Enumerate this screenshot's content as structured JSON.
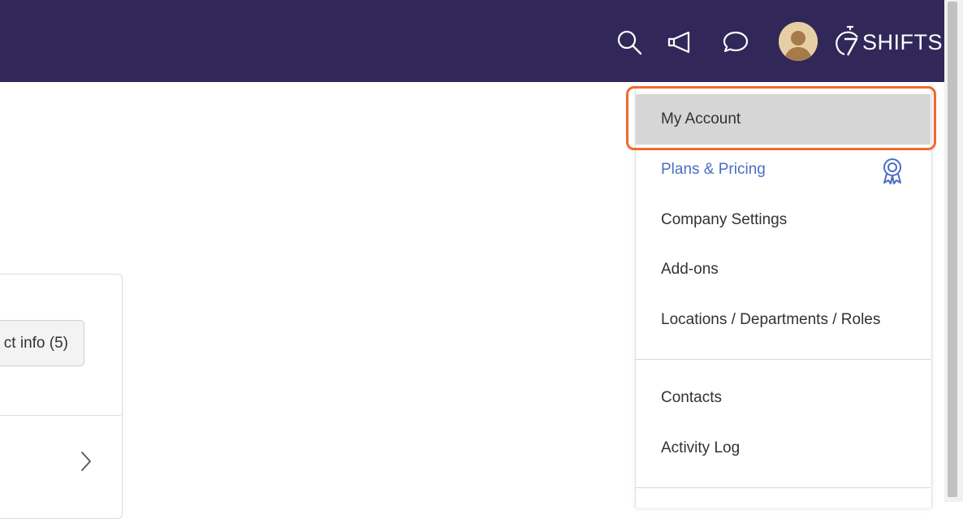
{
  "header": {
    "brand": "SHIFTS",
    "icons": [
      "search-icon",
      "megaphone-icon",
      "chat-icon"
    ],
    "colors": {
      "background": "#312859",
      "icon": "#ffffff"
    }
  },
  "card": {
    "button_label": "ct info (5)"
  },
  "menu": {
    "items": [
      {
        "label": "My Account",
        "active": true
      },
      {
        "label": "Plans & Pricing",
        "icon": "award-badge-icon",
        "color": "#4a6ec6"
      },
      {
        "label": "Company Settings"
      },
      {
        "label": "Add-ons"
      },
      {
        "label": "Locations / Departments / Roles"
      }
    ],
    "items_2": [
      {
        "label": "Contacts"
      },
      {
        "label": "Activity Log"
      }
    ],
    "highlight_color": "#f26a2e"
  }
}
